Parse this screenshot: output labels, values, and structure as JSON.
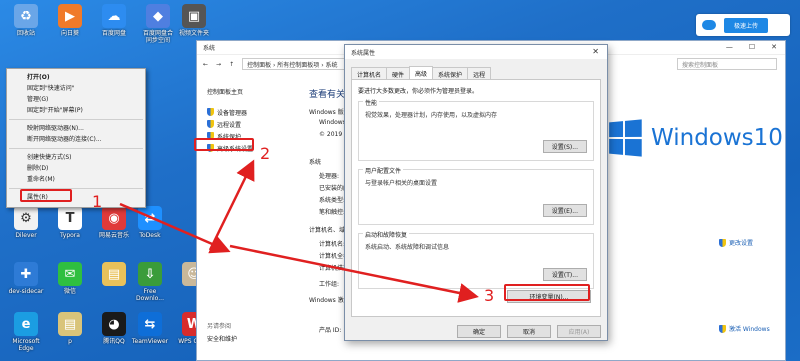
{
  "desktop_icons": [
    {
      "label": "回收站",
      "icon": "recycle-bin-icon",
      "color": "#6aa6e8",
      "glyph": "♻"
    },
    {
      "label": "向日葵",
      "icon": "sunflower-icon",
      "color": "#f07a2a",
      "glyph": "▶"
    },
    {
      "label": "百度网盘",
      "icon": "baidu-netdisk-icon",
      "color": "#2d8cf0",
      "glyph": "☁"
    },
    {
      "label": "百度网盘合\n同步空间",
      "icon": "baidu-sync-icon",
      "color": "#4f7fe0",
      "glyph": "◆"
    },
    {
      "label": "视频文件夹",
      "icon": "video-folder-icon",
      "color": "#555",
      "glyph": "▣"
    },
    {
      "label": "Dilever",
      "icon": "dilever-icon",
      "color": "#f2f2f2",
      "glyph": "⚙"
    },
    {
      "label": "Typora",
      "icon": "typora-icon",
      "color": "#ffffff",
      "glyph": "T"
    },
    {
      "label": "网易云音乐",
      "icon": "netease-music-icon",
      "color": "#e03a3a",
      "glyph": "◉"
    },
    {
      "label": "ToDesk",
      "icon": "todesk-icon",
      "color": "#1e90ff",
      "glyph": "⇄"
    },
    {
      "label": "dev-sidecar",
      "icon": "devsidecar-icon",
      "color": "#2e7bd6",
      "glyph": "✚"
    },
    {
      "label": "微信",
      "icon": "wechat-icon",
      "color": "#2fbf40",
      "glyph": "✉"
    },
    {
      "label": "",
      "icon": "folder-icon",
      "color": "#e8c15a",
      "glyph": "▤"
    },
    {
      "label": "Free\nDownlo...",
      "icon": "free-download-icon",
      "color": "#3a9c3a",
      "glyph": "⇩"
    },
    {
      "label": "",
      "icon": "anime-avatar-icon",
      "color": "#c9b89a",
      "glyph": "☺"
    },
    {
      "label": "Microsoft\nEdge",
      "icon": "edge-icon",
      "color": "#1b9de2",
      "glyph": "e"
    },
    {
      "label": "p",
      "icon": "file-icon",
      "color": "#d9c47a",
      "glyph": "▤"
    },
    {
      "label": "腾讯QQ",
      "icon": "qq-icon",
      "color": "#1a1a1a",
      "glyph": "◕"
    },
    {
      "label": "TeamViewer",
      "icon": "teamviewer-icon",
      "color": "#0e6ed8",
      "glyph": "⇆"
    },
    {
      "label": "WPS Offi...",
      "icon": "wps-icon",
      "color": "#d82c2c",
      "glyph": "W"
    }
  ],
  "context_menu": {
    "items": [
      "打开(O)",
      "固定到\"快速访问\"",
      "管理(G)",
      "固定到\"开始\"屏幕(P)",
      "映射网络驱动器(N)...",
      "断开网络驱动器的连接(C)...",
      "创建快捷方式(S)",
      "删除(D)",
      "重命名(M)",
      "属性(R)"
    ]
  },
  "system_window": {
    "title": "系统",
    "address": "控制面板 › 所有控制面板项 › 系统",
    "search_placeholder": "搜索控制面板",
    "nav": {
      "home": "控制面板主页",
      "links": [
        "设备管理器",
        "远程设置",
        "系统保护",
        "高级系统设置"
      ]
    },
    "see_also": "另请参阅",
    "security": "安全和维护",
    "main_title": "查看有关计",
    "labels": {
      "edition": "Windows 版",
      "win": "Windows",
      "copyright": "© 2019 M",
      "system": "系统",
      "processor": "处理器:",
      "ram": "已安装的内",
      "sys_type": "系统类型:",
      "pen": "笔和触控:",
      "computer_name_group": "计算机名、域",
      "computer_name": "计算机名:",
      "full_name": "计算机全名",
      "desc": "计算机描述",
      "workgroup": "工作组:",
      "activation": "Windows 激活",
      "product_id": "产品 ID:"
    },
    "windows10": "Windows10",
    "change_settings": "更改设置",
    "activate": "激活 Windows"
  },
  "dialog": {
    "title": "系统属性",
    "tabs": [
      "计算机名",
      "硬件",
      "高级",
      "系统保护",
      "远程"
    ],
    "active_tab": 2,
    "note": "要进行大多数更改，你必须作为管理员登录。",
    "groups": [
      {
        "title": "性能",
        "desc": "视觉效果，处理器计划，内存使用，以及虚拟内存",
        "btn": "设置(S)..."
      },
      {
        "title": "用户配置文件",
        "desc": "与登录帐户相关的桌面设置",
        "btn": "设置(E)..."
      },
      {
        "title": "启动和故障恢复",
        "desc": "系统启动、系统故障和调试信息",
        "btn": "设置(T)..."
      }
    ],
    "env_button": "环境变量(N)...",
    "ok": "确定",
    "cancel": "取消",
    "apply": "应用(A)"
  },
  "cloud_bar": {
    "upload": "极速上传"
  },
  "annotations": {
    "n1": "1",
    "n2": "2",
    "n3": "3"
  },
  "colors": {
    "annotation": "#e02020",
    "desktop": "#1f73c9",
    "accent": "#1a73d4"
  }
}
